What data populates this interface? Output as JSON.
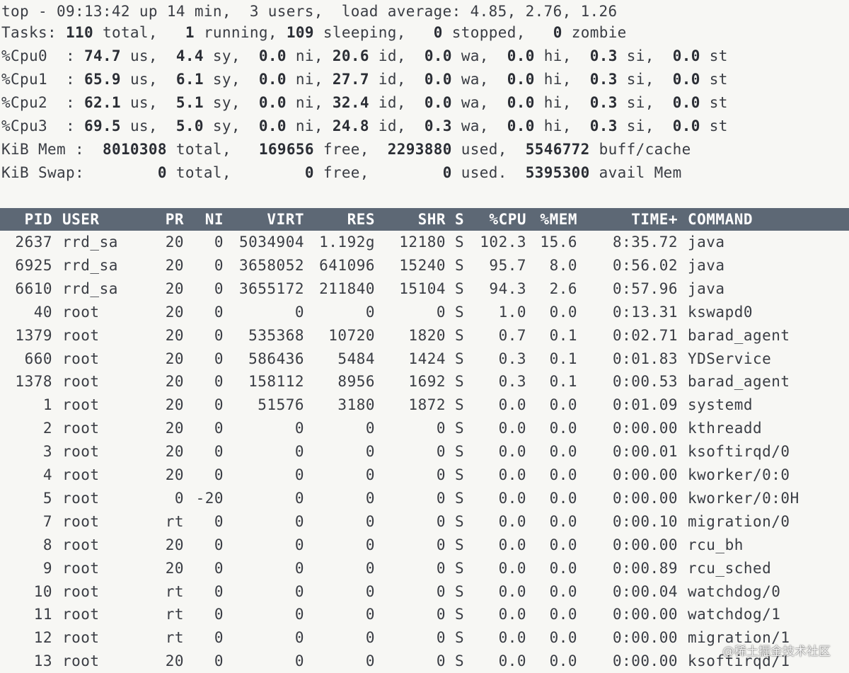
{
  "summary": {
    "top_line": "top - 09:13:42 up 14 min,  3 users,  load average: 4.85, 2.76, 1.26",
    "tasks": {
      "label": "Tasks:",
      "total": "110",
      "total_l": "total,",
      "running": "1",
      "running_l": "running,",
      "sleeping": "109",
      "sleeping_l": "sleeping,",
      "stopped": "0",
      "stopped_l": "stopped,",
      "zombie": "0",
      "zombie_l": "zombie"
    },
    "cpus": [
      {
        "label": "%Cpu0  :",
        "us": "74.7",
        "sy": "4.4",
        "ni": "0.0",
        "id": "20.6",
        "wa": "0.0",
        "hi": "0.0",
        "si": "0.3",
        "st": "0.0"
      },
      {
        "label": "%Cpu1  :",
        "us": "65.9",
        "sy": "6.1",
        "ni": "0.0",
        "id": "27.7",
        "wa": "0.0",
        "hi": "0.0",
        "si": "0.3",
        "st": "0.0"
      },
      {
        "label": "%Cpu2  :",
        "us": "62.1",
        "sy": "5.1",
        "ni": "0.0",
        "id": "32.4",
        "wa": "0.0",
        "hi": "0.0",
        "si": "0.3",
        "st": "0.0"
      },
      {
        "label": "%Cpu3  :",
        "us": "69.5",
        "sy": "5.0",
        "ni": "0.0",
        "id": "24.8",
        "wa": "0.3",
        "hi": "0.0",
        "si": "0.3",
        "st": "0.0"
      }
    ],
    "cpu_units": {
      "us": "us,",
      "sy": "sy,",
      "ni": "ni,",
      "id": "id,",
      "wa": "wa,",
      "hi": "hi,",
      "si": "si,",
      "st": "st"
    },
    "mem": {
      "label": "KiB Mem :",
      "total": "8010308",
      "total_l": "total,",
      "free": "169656",
      "free_l": "free,",
      "used": "2293880",
      "used_l": "used,",
      "cache": "5546772",
      "cache_l": "buff/cache"
    },
    "swap": {
      "label": "KiB Swap:",
      "total": "0",
      "total_l": "total,",
      "free": "0",
      "free_l": "free,",
      "used": "0",
      "used_l": "used.",
      "avail": "5395300",
      "avail_l": "avail Mem"
    }
  },
  "table": {
    "headers": {
      "pid": "PID",
      "user": "USER",
      "pr": "PR",
      "ni": "NI",
      "virt": "VIRT",
      "res": "RES",
      "shr": "SHR",
      "s": "S",
      "cpu": "%CPU",
      "mem": "%MEM",
      "time": "TIME+",
      "command": "COMMAND"
    },
    "rows": [
      {
        "pid": "2637",
        "user": "rrd_sa",
        "pr": "20",
        "ni": "0",
        "virt": "5034904",
        "res": "1.192g",
        "shr": "12180",
        "s": "S",
        "cpu": "102.3",
        "mem": "15.6",
        "time": "8:35.72",
        "command": "java"
      },
      {
        "pid": "6925",
        "user": "rrd_sa",
        "pr": "20",
        "ni": "0",
        "virt": "3658052",
        "res": "641096",
        "shr": "15240",
        "s": "S",
        "cpu": "95.7",
        "mem": "8.0",
        "time": "0:56.02",
        "command": "java"
      },
      {
        "pid": "6610",
        "user": "rrd_sa",
        "pr": "20",
        "ni": "0",
        "virt": "3655172",
        "res": "211840",
        "shr": "15104",
        "s": "S",
        "cpu": "94.3",
        "mem": "2.6",
        "time": "0:57.96",
        "command": "java"
      },
      {
        "pid": "40",
        "user": "root",
        "pr": "20",
        "ni": "0",
        "virt": "0",
        "res": "0",
        "shr": "0",
        "s": "S",
        "cpu": "1.0",
        "mem": "0.0",
        "time": "0:13.31",
        "command": "kswapd0"
      },
      {
        "pid": "1379",
        "user": "root",
        "pr": "20",
        "ni": "0",
        "virt": "535368",
        "res": "10720",
        "shr": "1820",
        "s": "S",
        "cpu": "0.7",
        "mem": "0.1",
        "time": "0:02.71",
        "command": "barad_agent"
      },
      {
        "pid": "660",
        "user": "root",
        "pr": "20",
        "ni": "0",
        "virt": "586436",
        "res": "5484",
        "shr": "1424",
        "s": "S",
        "cpu": "0.3",
        "mem": "0.1",
        "time": "0:01.83",
        "command": "YDService"
      },
      {
        "pid": "1378",
        "user": "root",
        "pr": "20",
        "ni": "0",
        "virt": "158112",
        "res": "8956",
        "shr": "1692",
        "s": "S",
        "cpu": "0.3",
        "mem": "0.1",
        "time": "0:00.53",
        "command": "barad_agent"
      },
      {
        "pid": "1",
        "user": "root",
        "pr": "20",
        "ni": "0",
        "virt": "51576",
        "res": "3180",
        "shr": "1872",
        "s": "S",
        "cpu": "0.0",
        "mem": "0.0",
        "time": "0:01.09",
        "command": "systemd"
      },
      {
        "pid": "2",
        "user": "root",
        "pr": "20",
        "ni": "0",
        "virt": "0",
        "res": "0",
        "shr": "0",
        "s": "S",
        "cpu": "0.0",
        "mem": "0.0",
        "time": "0:00.00",
        "command": "kthreadd"
      },
      {
        "pid": "3",
        "user": "root",
        "pr": "20",
        "ni": "0",
        "virt": "0",
        "res": "0",
        "shr": "0",
        "s": "S",
        "cpu": "0.0",
        "mem": "0.0",
        "time": "0:00.01",
        "command": "ksoftirqd/0"
      },
      {
        "pid": "4",
        "user": "root",
        "pr": "20",
        "ni": "0",
        "virt": "0",
        "res": "0",
        "shr": "0",
        "s": "S",
        "cpu": "0.0",
        "mem": "0.0",
        "time": "0:00.00",
        "command": "kworker/0:0"
      },
      {
        "pid": "5",
        "user": "root",
        "pr": "0",
        "ni": "-20",
        "virt": "0",
        "res": "0",
        "shr": "0",
        "s": "S",
        "cpu": "0.0",
        "mem": "0.0",
        "time": "0:00.00",
        "command": "kworker/0:0H"
      },
      {
        "pid": "7",
        "user": "root",
        "pr": "rt",
        "ni": "0",
        "virt": "0",
        "res": "0",
        "shr": "0",
        "s": "S",
        "cpu": "0.0",
        "mem": "0.0",
        "time": "0:00.10",
        "command": "migration/0"
      },
      {
        "pid": "8",
        "user": "root",
        "pr": "20",
        "ni": "0",
        "virt": "0",
        "res": "0",
        "shr": "0",
        "s": "S",
        "cpu": "0.0",
        "mem": "0.0",
        "time": "0:00.00",
        "command": "rcu_bh"
      },
      {
        "pid": "9",
        "user": "root",
        "pr": "20",
        "ni": "0",
        "virt": "0",
        "res": "0",
        "shr": "0",
        "s": "S",
        "cpu": "0.0",
        "mem": "0.0",
        "time": "0:00.89",
        "command": "rcu_sched"
      },
      {
        "pid": "10",
        "user": "root",
        "pr": "rt",
        "ni": "0",
        "virt": "0",
        "res": "0",
        "shr": "0",
        "s": "S",
        "cpu": "0.0",
        "mem": "0.0",
        "time": "0:00.04",
        "command": "watchdog/0"
      },
      {
        "pid": "11",
        "user": "root",
        "pr": "rt",
        "ni": "0",
        "virt": "0",
        "res": "0",
        "shr": "0",
        "s": "S",
        "cpu": "0.0",
        "mem": "0.0",
        "time": "0:00.00",
        "command": "watchdog/1"
      },
      {
        "pid": "12",
        "user": "root",
        "pr": "rt",
        "ni": "0",
        "virt": "0",
        "res": "0",
        "shr": "0",
        "s": "S",
        "cpu": "0.0",
        "mem": "0.0",
        "time": "0:00.00",
        "command": "migration/1"
      },
      {
        "pid": "13",
        "user": "root",
        "pr": "20",
        "ni": "0",
        "virt": "0",
        "res": "0",
        "shr": "0",
        "s": "S",
        "cpu": "0.0",
        "mem": "0.0",
        "time": "0:00.00",
        "command": "ksoftirqd/1"
      }
    ]
  },
  "watermark": "@稀土掘金技术社区",
  "colors": {
    "background": "#f7f7f4",
    "text": "#3a3d44",
    "header_bg": "#5d6875",
    "header_text": "#ffffff"
  }
}
